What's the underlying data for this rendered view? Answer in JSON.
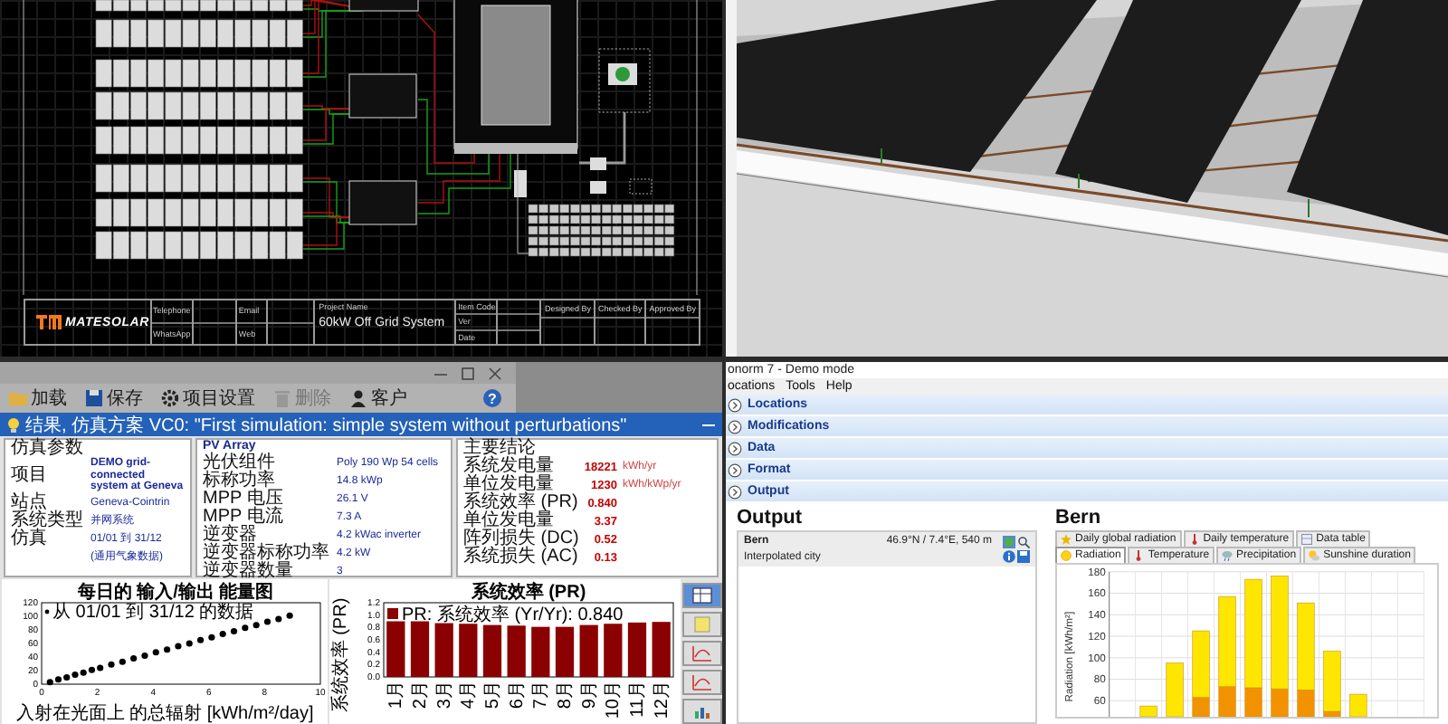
{
  "cad": {
    "logo": "MATESOLAR",
    "contact_labels": [
      "Telephone",
      "WhatsApp"
    ],
    "web_labels": [
      "Email",
      "Web"
    ],
    "project_label": "Project Name",
    "project_name": "60kW Off Grid System",
    "meta_labels": [
      "Item Code",
      "Ver",
      "Date"
    ],
    "sign_labels": [
      "Designed By",
      "Checked By",
      "Approved By"
    ]
  },
  "simulator": {
    "help_label": "?",
    "toolbar": [
      {
        "kind": "folder",
        "label": "加载",
        "disabled": false
      },
      {
        "kind": "save",
        "label": "保存",
        "disabled": false
      },
      {
        "kind": "gear",
        "label": "项目设置",
        "disabled": false
      },
      {
        "kind": "trash",
        "label": "删除",
        "disabled": true
      },
      {
        "kind": "person",
        "label": "客户",
        "disabled": false
      }
    ],
    "results_title": "结果, 仿真方案 VC0: \"First simulation: simple system without perturbations\"",
    "parameters": {
      "heading": "仿真参数",
      "rows": [
        {
          "label": "项目",
          "value": "DEMO grid-connected system at Geneva"
        },
        {
          "label": "站点",
          "value": "Geneva-Cointrin"
        },
        {
          "label": "系统类型",
          "value": "并网系统"
        },
        {
          "label": "仿真",
          "value": "01/01 到 31/12"
        },
        {
          "value": "(通用气象数据)"
        }
      ]
    },
    "pv_array": {
      "heading": "PV Array",
      "rows": [
        {
          "label": "光伏组件",
          "value": "Poly 190 Wp 54 cells"
        },
        {
          "label": "标称功率",
          "value": "14.8 kWp"
        },
        {
          "label": "MPP 电压",
          "value": "26.1 V"
        },
        {
          "label": "MPP 电流",
          "value": "7.3 A"
        },
        {
          "label": "逆变器",
          "value": "4.2 kWac inverter"
        },
        {
          "label": "逆变器标称功率",
          "value": "4.2 kW"
        },
        {
          "label": "逆变器数量",
          "value": "3"
        }
      ]
    },
    "main_results": {
      "heading": "主要结论",
      "rows": [
        {
          "label": "系统发电量",
          "value": "18221",
          "unit": "kWh/yr"
        },
        {
          "label": "单位发电量",
          "value": "1230",
          "unit": "kWh/kWp/yr"
        },
        {
          "label": "系统效率 (PR)",
          "value": "0.840"
        },
        {
          "label": "单位发电量",
          "value": "3.37"
        },
        {
          "label": "阵列损失 (DC)",
          "value": "0.52"
        },
        {
          "label": "系统损失 (AC)",
          "value": "0.13"
        }
      ]
    },
    "io_chart": {
      "chart_data": {
        "type": "scatter",
        "title": "每日的 输入/输出 能量图",
        "xlabel": "入射在光面上 的总辐射 [kWh/m²/day]",
        "xlim": [
          0,
          10
        ],
        "ylim": [
          0,
          120
        ],
        "xticks": [
          0,
          2,
          4,
          6,
          8,
          10
        ],
        "yticks": [
          0,
          20,
          40,
          60,
          80,
          100,
          120
        ],
        "x": [
          0.3,
          0.6,
          0.9,
          1.2,
          1.5,
          1.8,
          2.1,
          2.5,
          2.9,
          3.3,
          3.7,
          4.1,
          4.5,
          4.9,
          5.3,
          5.7,
          6.1,
          6.5,
          6.9,
          7.3,
          7.7,
          8.1,
          8.5,
          8.9
        ],
        "series": [
          {
            "name": "从 01/01 到 31/12 的数据",
            "color": "#000000",
            "values": [
              3,
              7,
              10,
              14,
              17,
              21,
              24,
              29,
              33,
              38,
              42,
              47,
              51,
              56,
              60,
              65,
              69,
              74,
              78,
              83,
              87,
              92,
              96,
              101
            ]
          }
        ]
      }
    },
    "pr_chart": {
      "chart_data": {
        "type": "bar",
        "title": "系统效率 (PR)",
        "ylabel": "系统效率 (PR)",
        "categories": [
          "1月",
          "2月",
          "3月",
          "4月",
          "5月",
          "6月",
          "7月",
          "8月",
          "9月",
          "10月",
          "11月",
          "12月"
        ],
        "ylim": [
          0,
          1.2
        ],
        "yticks": [
          {
            "value": 0,
            "label": "0.0"
          },
          {
            "value": 0.2,
            "label": "0.2"
          },
          {
            "value": 0.4,
            "label": "0.4"
          },
          {
            "value": 0.6,
            "label": "0.6"
          },
          {
            "value": 0.8,
            "label": "0.8"
          },
          {
            "value": 1,
            "label": "1.0"
          },
          {
            "value": 1.2,
            "label": "1.2"
          }
        ],
        "series": [
          {
            "name": "PR: 系统效率 (Yr/Yr): 0.840",
            "color": "#8b0000",
            "values": [
              0.9,
              0.9,
              0.87,
              0.86,
              0.84,
              0.83,
              0.81,
              0.81,
              0.84,
              0.86,
              0.88,
              0.89
            ]
          }
        ]
      }
    },
    "tool_buttons": [
      {
        "kind": "table",
        "selected": true
      },
      {
        "kind": "note",
        "selected": false
      },
      {
        "kind": "curve",
        "selected": false
      },
      {
        "kind": "curve",
        "selected": false
      },
      {
        "kind": "stats",
        "selected": false
      }
    ]
  },
  "meteonorm": {
    "window_title": "onorm 7 - Demo mode",
    "menu": [
      "ocations",
      "Tools",
      "Help"
    ],
    "sections": [
      "Locations",
      "Modifications",
      "Data",
      "Format",
      "Output"
    ],
    "output_heading": "Output",
    "locations": [
      {
        "name": "Bern",
        "coordinates": "46.9°N / 7.4°E, 540 m",
        "type": "Interpolated city",
        "selected": true
      }
    ],
    "detail_heading": "Bern",
    "tab_rows": [
      [
        {
          "kind": "star",
          "label": "Daily global radiation",
          "selected": false
        },
        {
          "kind": "thermometer",
          "label": "Daily temperature",
          "selected": false
        },
        {
          "kind": "table",
          "label": "Data table",
          "selected": false
        }
      ],
      [
        {
          "kind": "sun",
          "label": "Radiation",
          "selected": true
        },
        {
          "kind": "thermometer",
          "label": "Temperature",
          "selected": false
        },
        {
          "kind": "rain",
          "label": "Precipitation",
          "selected": false
        },
        {
          "kind": "sun-cloud",
          "label": "Sunshine duration",
          "selected": false
        }
      ]
    ],
    "chart_data": {
      "type": "bar",
      "stacked": true,
      "grid": true,
      "ylabel": "Radiation [kWh/m²]",
      "ylim": [
        45,
        180
      ],
      "yticks": [
        60,
        80,
        100,
        120,
        140,
        160,
        180
      ],
      "series": [
        {
          "color": "#f39200",
          "values": [
            null,
            null,
            45,
            63,
            73,
            72,
            71,
            70,
            50,
            null,
            null,
            null
          ]
        },
        {
          "color": "#ffe600",
          "values": [
            null,
            55,
            50,
            62,
            84,
            101,
            105,
            81,
            56,
            66,
            null,
            null
          ]
        }
      ]
    }
  }
}
